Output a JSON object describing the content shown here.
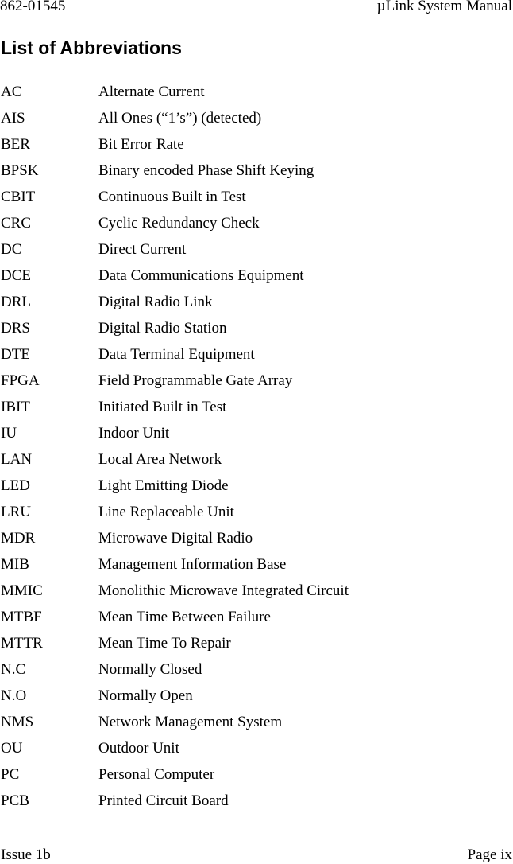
{
  "header": {
    "doc_number": "862-01545",
    "manual_title": "µLink System Manual"
  },
  "title": "List of Abbreviations",
  "abbreviations": [
    {
      "term": "AC",
      "definition": "Alternate Current"
    },
    {
      "term": "AIS",
      "definition": "All Ones (“1’s”) (detected)"
    },
    {
      "term": "BER",
      "definition": "Bit Error Rate"
    },
    {
      "term": "BPSK",
      "definition": "Binary encoded Phase Shift Keying"
    },
    {
      "term": "CBIT",
      "definition": "Continuous Built in Test"
    },
    {
      "term": "CRC",
      "definition": "Cyclic Redundancy Check"
    },
    {
      "term": "DC",
      "definition": "Direct Current"
    },
    {
      "term": "DCE",
      "definition": "Data Communications Equipment"
    },
    {
      "term": "DRL",
      "definition": "Digital Radio Link"
    },
    {
      "term": "DRS",
      "definition": "Digital Radio Station"
    },
    {
      "term": "DTE",
      "definition": "Data Terminal Equipment"
    },
    {
      "term": "FPGA",
      "definition": "Field Programmable Gate Array"
    },
    {
      "term": "IBIT",
      "definition": "Initiated Built in Test"
    },
    {
      "term": "IU",
      "definition": "Indoor Unit"
    },
    {
      "term": "LAN",
      "definition": "Local Area Network"
    },
    {
      "term": "LED",
      "definition": "Light Emitting Diode"
    },
    {
      "term": "LRU",
      "definition": "Line Replaceable Unit"
    },
    {
      "term": "MDR",
      "definition": "Microwave Digital Radio"
    },
    {
      "term": "MIB",
      "definition": "Management Information Base"
    },
    {
      "term": "MMIC",
      "definition": "Monolithic Microwave Integrated Circuit"
    },
    {
      "term": "MTBF",
      "definition": "Mean Time Between Failure"
    },
    {
      "term": "MTTR",
      "definition": "Mean Time To Repair"
    },
    {
      "term": "N.C",
      "definition": "Normally Closed"
    },
    {
      "term": "N.O",
      "definition": "Normally Open"
    },
    {
      "term": "NMS",
      "definition": "Network Management System"
    },
    {
      "term": "OU",
      "definition": "Outdoor Unit"
    },
    {
      "term": "PC",
      "definition": "Personal Computer"
    },
    {
      "term": "PCB",
      "definition": "Printed Circuit Board"
    }
  ],
  "footer": {
    "issue": "Issue 1b",
    "page": "Page ix"
  }
}
